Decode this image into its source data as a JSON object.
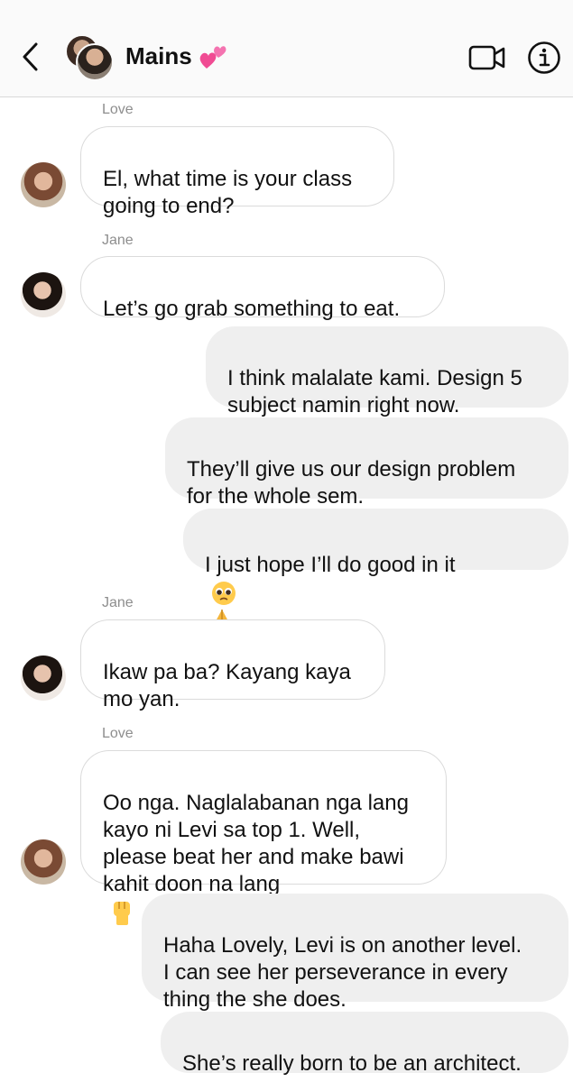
{
  "header": {
    "title": "Mains",
    "title_emoji": "two-hearts-emoji",
    "back_icon": "chevron-left-icon",
    "video_icon": "video-camera-icon",
    "info_icon": "info-icon"
  },
  "messages": [
    {
      "sender": "Love",
      "direction": "incoming",
      "text": "El, what time is your class\ngoing to end?"
    },
    {
      "sender": "Jane",
      "direction": "incoming",
      "text": "Let’s go grab something to eat."
    },
    {
      "sender": "",
      "direction": "outgoing",
      "text": "I think malalate kami. Design 5\nsubject namin right now."
    },
    {
      "sender": "",
      "direction": "outgoing",
      "text": "They’ll give us our design problem\nfor the whole sem."
    },
    {
      "sender": "",
      "direction": "outgoing",
      "text": "I just hope I’ll do good in it",
      "emojis": [
        "pleading-face-emoji",
        "folded-hands-emoji"
      ]
    },
    {
      "sender": "Jane",
      "direction": "incoming",
      "text": "Ikaw pa ba? Kayang kaya\nmo yan."
    },
    {
      "sender": "Love",
      "direction": "incoming",
      "text": "Oo nga. Naglalabanan nga lang\nkayo ni Levi sa top 1. Well,\nplease beat her and make bawi\nkahit doon na lang",
      "emojis": [
        "raised-fist-emoji"
      ]
    },
    {
      "sender": "",
      "direction": "outgoing",
      "text": "Haha Lovely, Levi is on another level.\nI can see her perseverance in every\nthing the she does."
    },
    {
      "sender": "",
      "direction": "outgoing",
      "text": "She’s really born to be an architect."
    }
  ],
  "colors": {
    "header_bg": "#fafafa",
    "incoming_bubble_bg": "#ffffff",
    "incoming_bubble_border": "#dbdbdb",
    "outgoing_bubble_bg": "#efefef",
    "sender_label": "#8e8e8e"
  }
}
